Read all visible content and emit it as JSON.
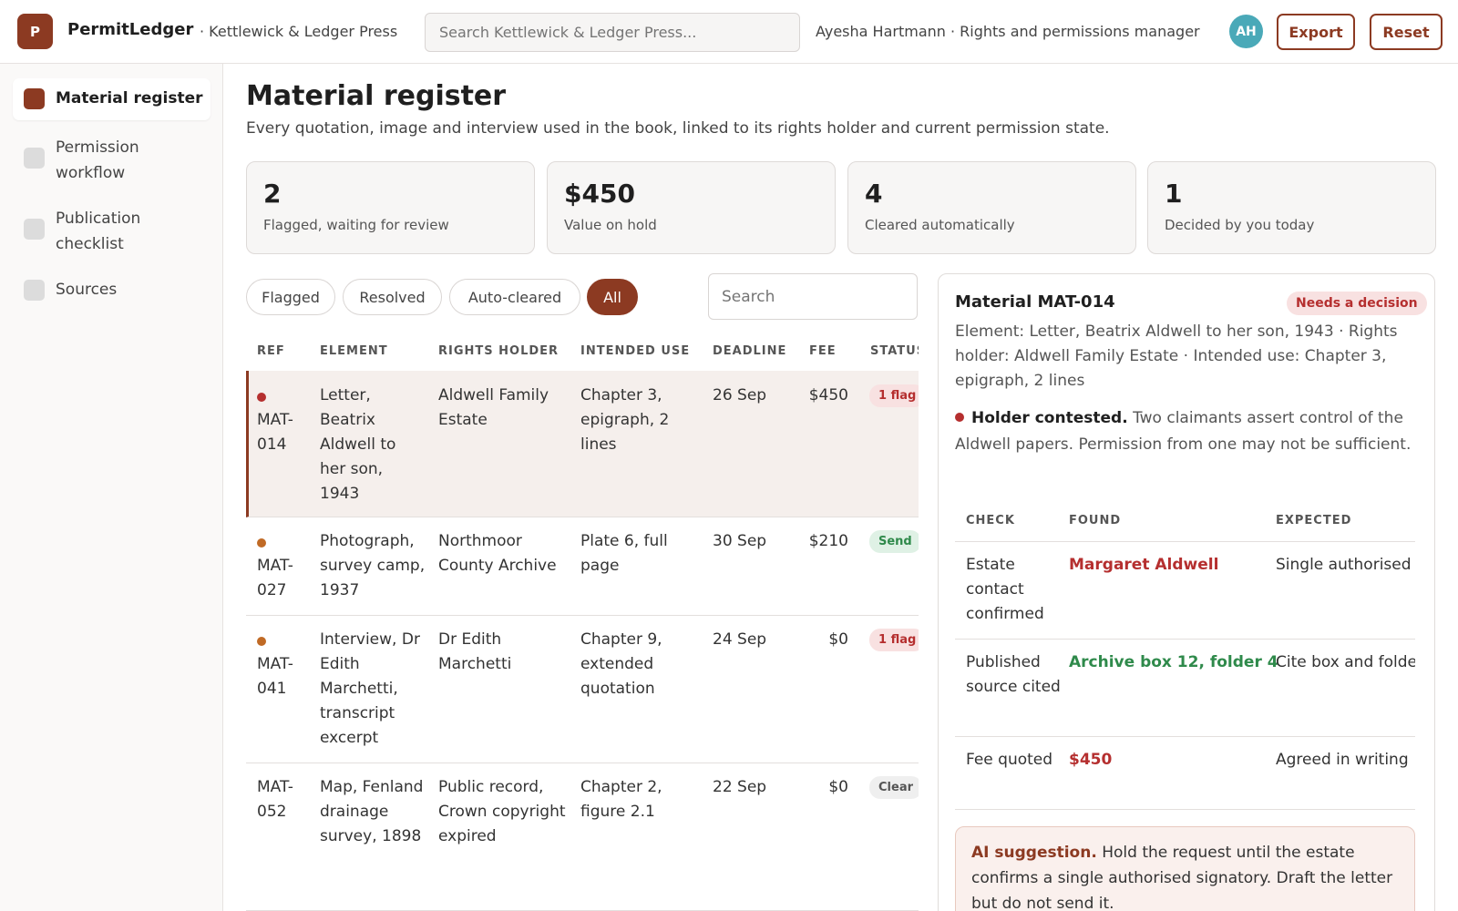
{
  "header": {
    "logo_letter": "P",
    "app_name": "PermitLedger",
    "org_name": "· Kettlewick & Ledger Press",
    "search_placeholder": "Search Kettlewick & Ledger Press...",
    "user": "Ayesha Hartmann · Rights and permissions manager",
    "avatar_initials": "AH",
    "export_label": "Export",
    "reset_label": "Reset"
  },
  "sidebar": {
    "items": [
      {
        "label": "Material register",
        "active": true
      },
      {
        "label": "Permission workflow",
        "active": false
      },
      {
        "label": "Publication checklist",
        "active": false
      },
      {
        "label": "Sources",
        "active": false
      }
    ]
  },
  "main": {
    "title": "Material register",
    "subtitle": "Every quotation, image and interview used in the book, linked to its rights holder and current permission state.",
    "stats": [
      {
        "value": "2",
        "label": "Flagged, waiting for review"
      },
      {
        "value": "$450",
        "label": "Value on hold"
      },
      {
        "value": "4",
        "label": "Cleared automatically"
      },
      {
        "value": "1",
        "label": "Decided by you today"
      }
    ],
    "filters": [
      {
        "label": "Flagged",
        "active": false
      },
      {
        "label": "Resolved",
        "active": false
      },
      {
        "label": "Auto-cleared",
        "active": false
      },
      {
        "label": "All",
        "active": true
      }
    ],
    "table_search_placeholder": "Search",
    "columns": [
      "REF",
      "ELEMENT",
      "RIGHTS HOLDER",
      "INTENDED USE",
      "DEADLINE",
      "FEE",
      "STATUS"
    ],
    "rows": [
      {
        "ref": "MAT-014",
        "element": "Letter, Beatrix Aldwell to her son, 1943",
        "holder": "Aldwell Family Estate",
        "use": "Chapter 3, epigraph, 2 lines",
        "deadline": "26 Sep",
        "fee": "$450",
        "status": "1 flag",
        "dot_color": "#b52f2f"
      },
      {
        "ref": "MAT-027",
        "element": "Photograph, survey camp, 1937",
        "holder": "Northmoor County Archive",
        "use": "Plate 6, full page",
        "deadline": "30 Sep",
        "fee": "$210",
        "status": "Send",
        "dot_color": "#c06a25"
      },
      {
        "ref": "MAT-041",
        "element": "Interview, Dr Edith Marchetti, transcript excerpt",
        "holder": "Dr Edith Marchetti",
        "use": "Chapter 9, extended quotation",
        "deadline": "24 Sep",
        "fee": "$0",
        "status": "1 flag",
        "dot_color": "#c06a25"
      },
      {
        "ref": "MAT-052",
        "element": "Map, Fenland drainage survey, 1898",
        "holder": "Public record, Crown copyright expired",
        "use": "Chapter 2, figure 2.1",
        "deadline": "22 Sep",
        "fee": "$0",
        "status": "Clear",
        "dot_color": ""
      }
    ]
  },
  "detail": {
    "title": "Material MAT-014",
    "badge": "Needs a decision",
    "meta": "Element: Letter, Beatrix Aldwell to her son, 1943 · Rights holder: Aldwell Family Estate · Intended use: Chapter 3, epigraph, 2 lines",
    "contested_title": "Holder contested.",
    "contested_text": "Two claimants assert control of the Aldwell papers. Permission from one may not be sufficient.",
    "check_columns": [
      "CHECK",
      "FOUND",
      "EXPECTED"
    ],
    "checks": [
      {
        "check": "Estate contact confirmed",
        "found": "Margaret Aldwell",
        "expected": "Single authorised signatory",
        "found_style": "red"
      },
      {
        "check": "Published source cited",
        "found": "Archive box 12, folder 4",
        "expected": "Cite box and folder",
        "found_style": "green"
      },
      {
        "check": "Fee quoted",
        "found": "$450",
        "expected": "Agreed in writing",
        "found_style": "red"
      }
    ],
    "ai_label": "AI suggestion.",
    "ai_text": "Hold the request until the estate confirms a single authorised signatory. Draft the letter but do not send it."
  },
  "colors": {
    "accent": "#8c3a22",
    "flag_red": "#b52f2f",
    "ok_green": "#2f8a4b",
    "avatar": "#4aa9b8"
  }
}
